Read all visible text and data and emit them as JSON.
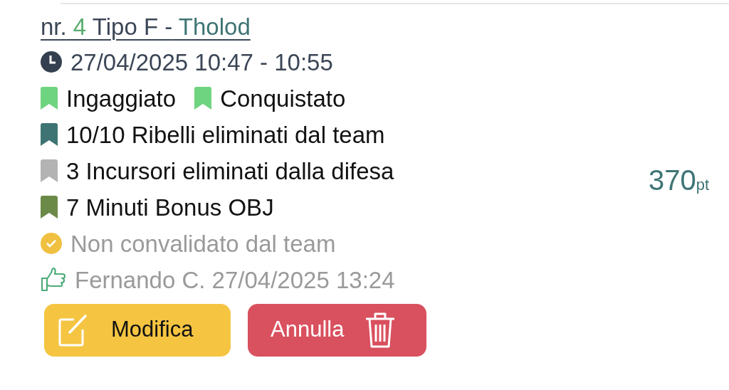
{
  "title": {
    "parts": [
      {
        "kind": "plain",
        "text": "nr."
      },
      {
        "kind": "number",
        "text": "4"
      },
      {
        "kind": "plain",
        "text": "Tipo F -"
      },
      {
        "kind": "name",
        "text": "Tholod"
      }
    ]
  },
  "time": "27/04/2025 10:47 - 10:55",
  "tag_rows": [
    {
      "tags": [
        {
          "text": "Ingaggiato",
          "color": "#6fd47f"
        },
        {
          "text": "Conquistato",
          "color": "#6fd47f"
        }
      ]
    },
    {
      "tags": [
        {
          "text": "10/10 Ribelli eliminati dal team",
          "color": "#3f7474"
        }
      ]
    },
    {
      "tags": [
        {
          "text": "3 Incursori eliminati dalla difesa",
          "color": "#b3b3b3"
        }
      ]
    },
    {
      "tags": [
        {
          "text": "7 Minuti Bonus OBJ",
          "color": "#6b8a48"
        }
      ]
    }
  ],
  "validation": {
    "text": "Non convalidato dal team",
    "validated": false
  },
  "approval": "Fernando C. 27/04/2025 13:24",
  "points": {
    "value": "370",
    "unit": "pt"
  },
  "buttons": [
    {
      "kind": "edit",
      "label": "Modifica"
    },
    {
      "kind": "delete",
      "label": "Annulla"
    }
  ]
}
